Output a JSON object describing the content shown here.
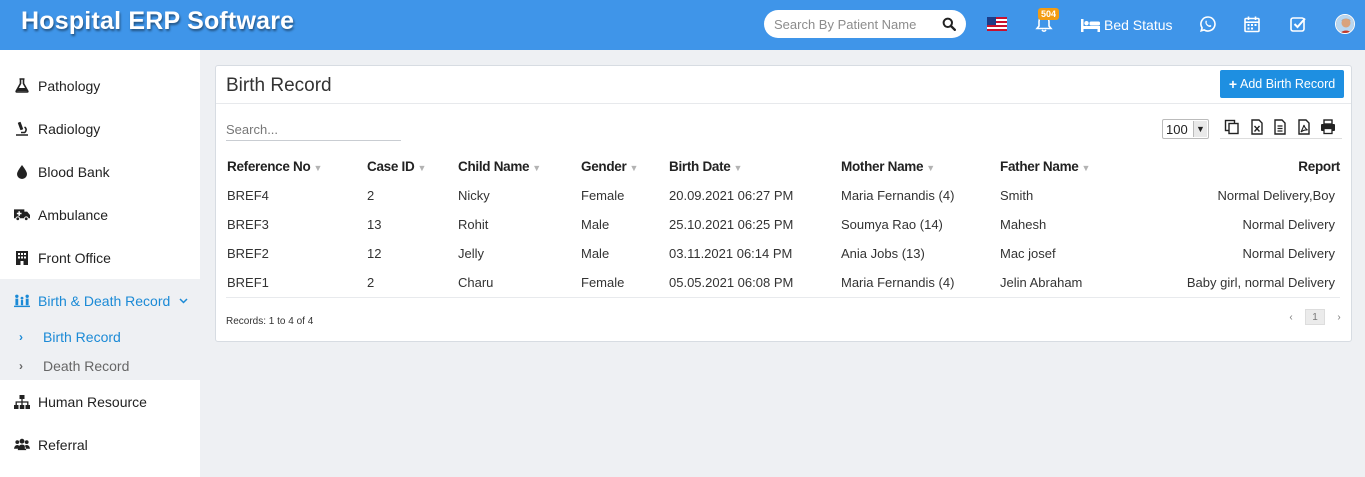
{
  "app": {
    "title": "Hospital ERP Software"
  },
  "header": {
    "search_placeholder": "Search By Patient Name",
    "notification_count": "504",
    "bed_status_label": "Bed Status",
    "icons": [
      "search-icon",
      "us-flag-icon",
      "bell-icon",
      "bed-icon",
      "whatsapp-icon",
      "calendar-icon",
      "task-check-icon",
      "user-avatar"
    ]
  },
  "sidebar": {
    "items": [
      {
        "label": "Pathology",
        "icon": "flask-icon"
      },
      {
        "label": "Radiology",
        "icon": "microscope-icon"
      },
      {
        "label": "Blood Bank",
        "icon": "blood-drop-icon"
      },
      {
        "label": "Ambulance",
        "icon": "ambulance-icon"
      },
      {
        "label": "Front Office",
        "icon": "building-icon"
      },
      {
        "label": "Birth & Death Record",
        "icon": "family-icon",
        "expanded": true
      },
      {
        "label": "Human Resource",
        "icon": "sitemap-icon"
      },
      {
        "label": "Referral",
        "icon": "users-icon"
      }
    ],
    "sub_items": [
      {
        "label": "Birth Record",
        "active": true
      },
      {
        "label": "Death Record",
        "active": false
      }
    ]
  },
  "page": {
    "title": "Birth Record",
    "add_button_label": "Add Birth Record",
    "search_placeholder": "Search...",
    "page_size": "100",
    "tools": [
      "copy-icon",
      "excel-icon",
      "csv-icon",
      "pdf-icon",
      "print-icon"
    ]
  },
  "table": {
    "columns": [
      "Reference No",
      "Case ID",
      "Child Name",
      "Gender",
      "Birth Date",
      "Mother Name",
      "Father Name",
      "Report"
    ],
    "rows": [
      [
        "BREF4",
        "2",
        "Nicky",
        "Female",
        "20.09.2021 06:27 PM",
        "Maria Fernandis (4)",
        "Smith",
        "Normal Delivery,Boy"
      ],
      [
        "BREF3",
        "13",
        "Rohit",
        "Male",
        "25.10.2021 06:25 PM",
        "Soumya Rao (14)",
        "Mahesh",
        "Normal Delivery"
      ],
      [
        "BREF2",
        "12",
        "Jelly",
        "Male",
        "03.11.2021 06:14 PM",
        "Ania Jobs (13)",
        "Mac josef",
        "Normal Delivery"
      ],
      [
        "BREF1",
        "2",
        "Charu",
        "Female",
        "05.05.2021 06:08 PM",
        "Maria Fernandis (4)",
        "Jelin Abraham",
        "Baby girl, normal Delivery"
      ]
    ]
  },
  "footer": {
    "records_text": "Records: 1 to 4 of 4",
    "prev": "‹",
    "current_page": "1",
    "next": "›"
  },
  "colors": {
    "topbar": "#3f95e9",
    "accent": "#1e8fe1",
    "active_text": "#1b8ad6",
    "badge": "#f39c12"
  }
}
